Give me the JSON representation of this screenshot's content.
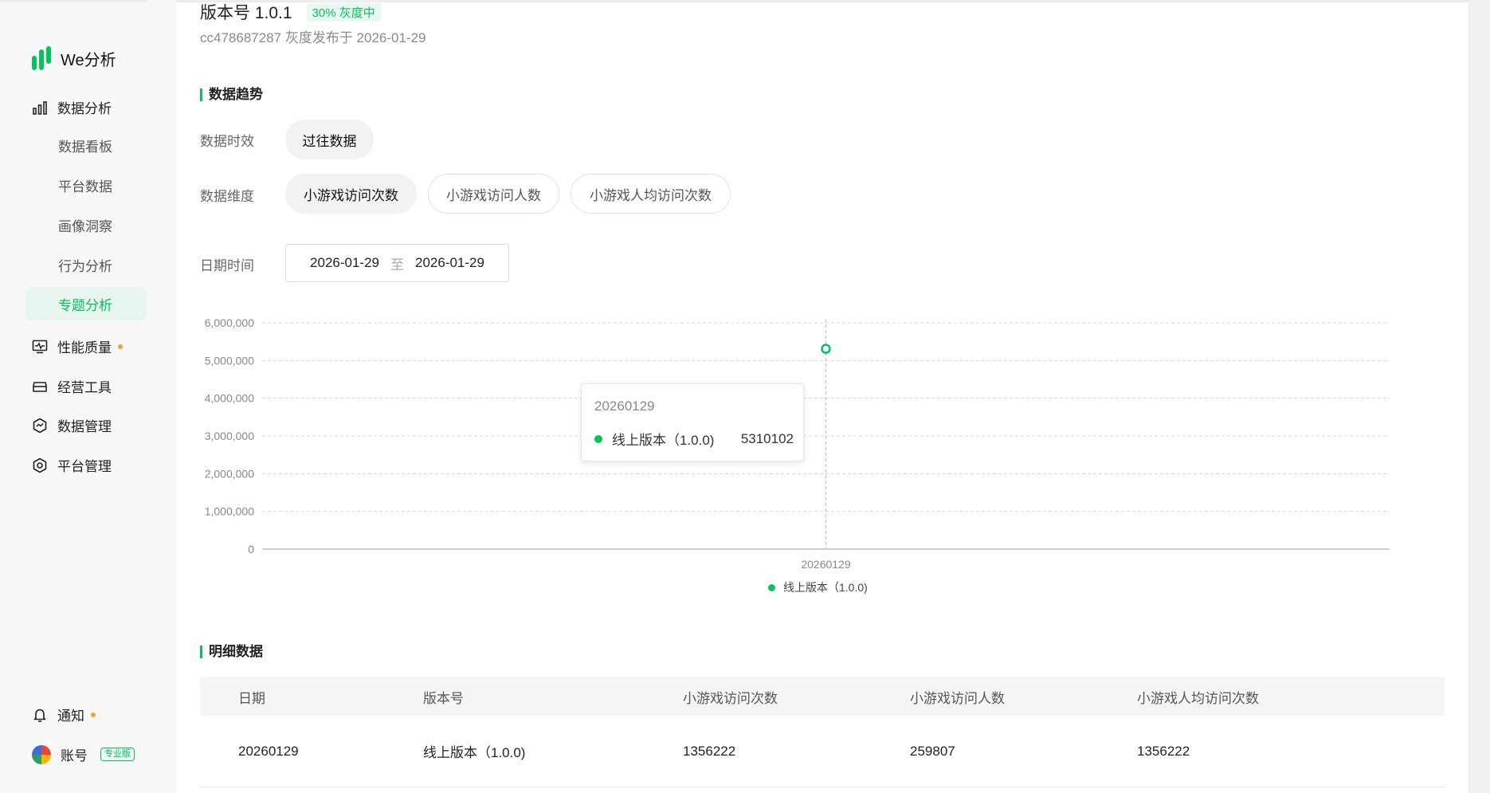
{
  "app": {
    "brand_name": "We分析",
    "brand_color": "#07c160"
  },
  "sidebar": {
    "sections": [
      {
        "label": "数据分析",
        "icon": "bar-chart-icon",
        "expanded": true,
        "items": [
          {
            "label": "数据看板",
            "active": false
          },
          {
            "label": "平台数据",
            "active": false
          },
          {
            "label": "画像洞察",
            "active": false
          },
          {
            "label": "行为分析",
            "active": false
          },
          {
            "label": "专题分析",
            "active": true
          }
        ]
      },
      {
        "label": "性能质量",
        "icon": "monitor-icon",
        "dot": true
      },
      {
        "label": "经营工具",
        "icon": "toolbox-icon"
      },
      {
        "label": "数据管理",
        "icon": "data-manage-icon"
      },
      {
        "label": "平台管理",
        "icon": "settings-hexagon-icon"
      }
    ],
    "bottom": {
      "notice_label": "通知",
      "notice_dot": true,
      "account_label": "账号",
      "account_badge": "专业版"
    }
  },
  "header": {
    "version_title": "版本号 1.0.1",
    "gray_tag": "30% 灰度中",
    "release_info": "cc478687287 灰度发布于 2026-01-29"
  },
  "trend": {
    "title": "数据趋势",
    "time_label": "数据时效",
    "time_options": [
      "过往数据"
    ],
    "dimension_label": "数据维度",
    "dimension_options": [
      "小游戏访问次数",
      "小游戏访问人数",
      "小游戏人均访问次数"
    ],
    "dimension_selected": "小游戏访问次数",
    "date_label": "日期时间",
    "date_start": "2026-01-29",
    "date_sep": "至",
    "date_end": "2026-01-29"
  },
  "chart_data": {
    "type": "line",
    "x": [
      "20260129"
    ],
    "series": [
      {
        "name": "线上版本（1.0.0)",
        "values": [
          5310102
        ],
        "color": "#07c160"
      }
    ],
    "yticks": [
      "0",
      "1,000,000",
      "2,000,000",
      "3,000,000",
      "4,000,000",
      "5,000,000",
      "6,000,000"
    ],
    "ylim": [
      0,
      6000000
    ],
    "grid": true,
    "legend": "bottom",
    "tooltip": {
      "date": "20260129",
      "series": "线上版本（1.0.0)",
      "value": "5310102"
    }
  },
  "detail": {
    "title": "明细数据",
    "columns": [
      "日期",
      "版本号",
      "小游戏访问次数",
      "小游戏访问人数",
      "小游戏人均访问次数"
    ],
    "rows": [
      [
        "20260129",
        "线上版本（1.0.0)",
        "1356222",
        "259807",
        "1356222"
      ]
    ]
  }
}
